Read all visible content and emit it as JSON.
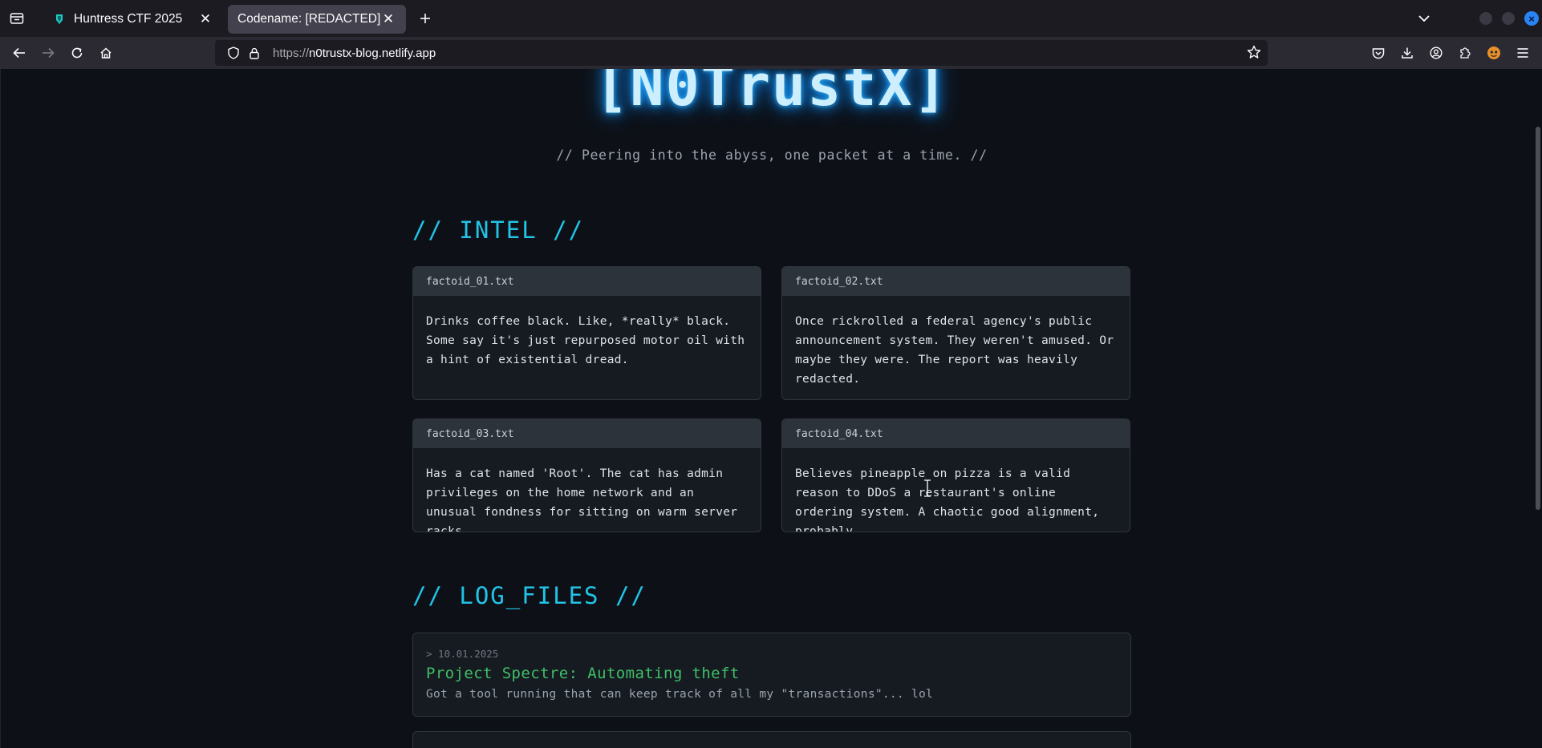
{
  "browser": {
    "tabs": [
      {
        "title": "Huntress CTF 2025",
        "active": false
      },
      {
        "title": "Codename: [REDACTED]",
        "active": true
      }
    ],
    "url_protocol": "https://",
    "url_host": "n0trustx-blog.netlify.app",
    "accent_color": "#2a83f5"
  },
  "page": {
    "logo": "[N0TrustX]",
    "tagline": "// Peering into the abyss, one packet at a time. //",
    "intel_heading": "// INTEL //",
    "factoids": [
      {
        "file": "factoid_01.txt",
        "text": "Drinks coffee black. Like, *really* black. Some say it's just repurposed motor oil with a hint of existential dread."
      },
      {
        "file": "factoid_02.txt",
        "text": "Once rickrolled a federal agency's public announcement system. They weren't amused. Or maybe they were. The report was heavily redacted."
      },
      {
        "file": "factoid_03.txt",
        "text": "Has a cat named 'Root'. The cat has admin privileges on the home network and an unusual fondness for sitting on warm server racks."
      },
      {
        "file": "factoid_04.txt",
        "text": "Believes pineapple on pizza is a valid reason to DDoS a restaurant's online ordering system. A chaotic good alignment, probably."
      }
    ],
    "logs_heading": "// LOG_FILES //",
    "logs": [
      {
        "date": "> 10.01.2025",
        "title": "Project Spectre: Automating theft",
        "desc": "Got a tool running that can keep track of all my \"transactions\"... lol"
      }
    ],
    "colors": {
      "background": "#0d1117",
      "heading_cyan": "#22c3e6",
      "log_title_green": "#3fbf66",
      "logo_glow": "#1596ff"
    }
  }
}
